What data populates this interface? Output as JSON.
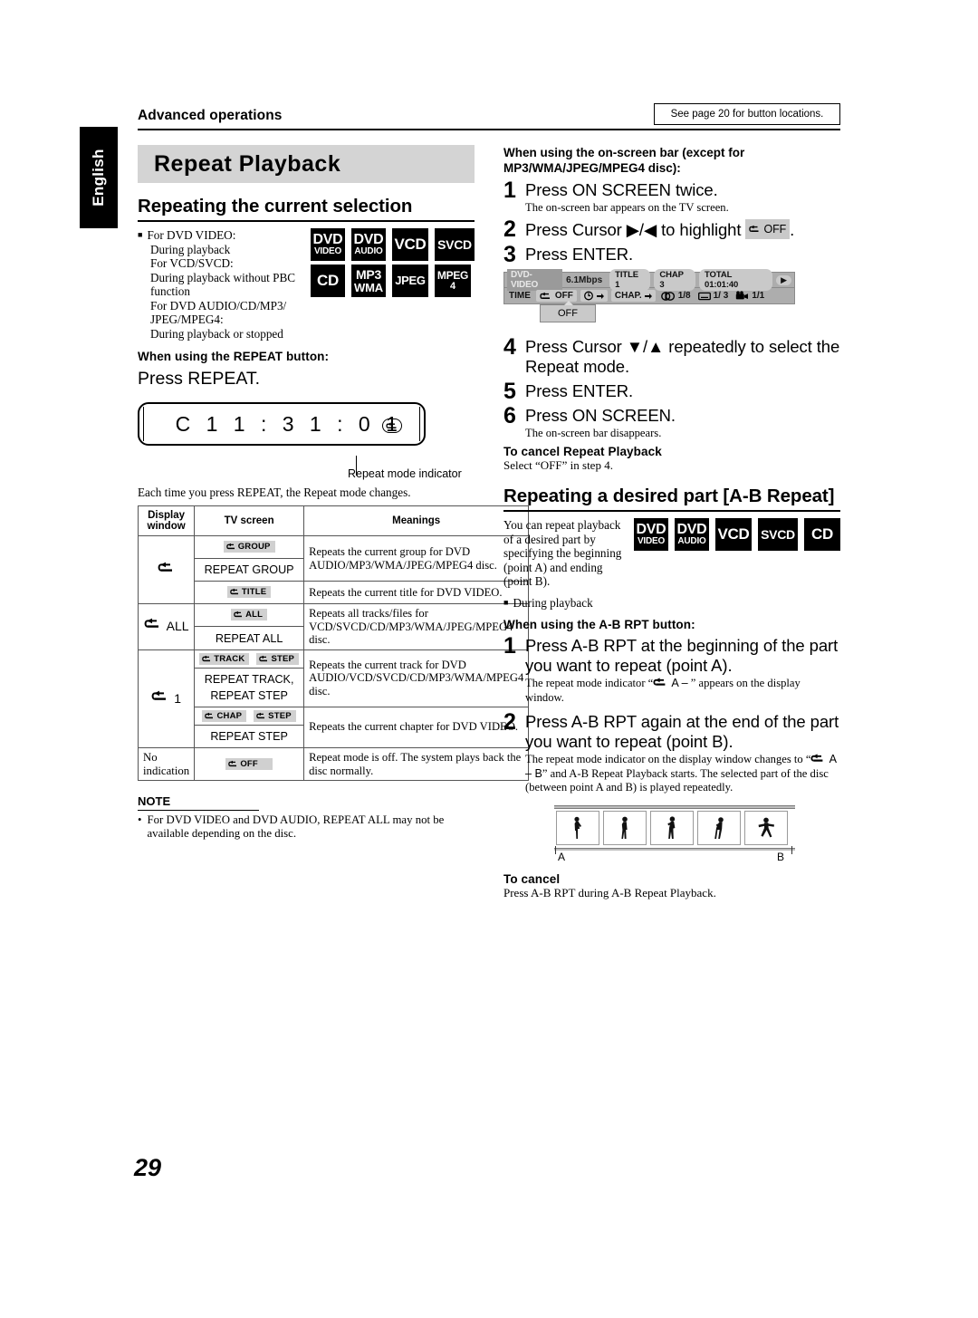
{
  "header": {
    "language_tab": "English",
    "section_label": "Advanced operations",
    "page_reference": "See page 20 for button locations.",
    "page_number": "29"
  },
  "left_column": {
    "banner_title": "Repeat Playback",
    "subsection_title": "Repeating the current selection",
    "intro_lines": [
      "For DVD VIDEO:",
      "During playback",
      "For VCD/SVCD:",
      "During playback without PBC",
      "function",
      "For DVD AUDIO/CD/MP3/",
      "JPEG/MPEG4:",
      "During playback or stopped"
    ],
    "disc_badges": [
      {
        "line1": "DVD",
        "line2": "VIDEO"
      },
      {
        "line1": "DVD",
        "line2": "AUDIO"
      },
      {
        "line1": "VCD",
        "line2": ""
      },
      {
        "line1": "SVCD",
        "line2": ""
      },
      {
        "line1": "CD",
        "line2": ""
      },
      {
        "line1": "MP3",
        "line2": "WMA"
      },
      {
        "line1": "JPEG",
        "line2": ""
      },
      {
        "line1": "MPEG",
        "line2": "4"
      }
    ],
    "button_heading": "When using the REPEAT button:",
    "press_instruction": "Press REPEAT.",
    "display_window_text": "C 1  1 : 3 1 : 0 1",
    "indicator_caption": "Repeat mode indicator",
    "each_time_text": "Each time you press REPEAT, the Repeat mode changes.",
    "table": {
      "headers": [
        "Display window",
        "TV screen",
        "Meanings"
      ],
      "rows": [
        {
          "display_window": "loop",
          "display_window_suffix": "",
          "tv_screens": [
            {
              "kind": "chip",
              "chips": [
                "GROUP"
              ]
            },
            {
              "kind": "plain",
              "text": "REPEAT GROUP"
            }
          ],
          "meaning": "Repeats the current group for DVD AUDIO/MP3/WMA/JPEG/MPEG4 disc."
        },
        {
          "display_window": "",
          "display_window_suffix": "",
          "tv_screens": [
            {
              "kind": "chip",
              "chips": [
                "TITLE"
              ]
            }
          ],
          "meaning": "Repeats the current title for DVD VIDEO."
        },
        {
          "display_window": "loop",
          "display_window_suffix": "ALL",
          "tv_screens": [
            {
              "kind": "chip",
              "chips": [
                "ALL"
              ]
            },
            {
              "kind": "plain",
              "text": "REPEAT ALL"
            }
          ],
          "meaning": "Repeats all tracks/files for VCD/SVCD/CD/MP3/WMA/JPEG/MPEG4 disc."
        },
        {
          "display_window": "loop",
          "display_window_suffix": "1",
          "tv_screens": [
            {
              "kind": "chip",
              "chips": [
                "TRACK",
                "STEP"
              ]
            },
            {
              "kind": "plain",
              "text": "REPEAT TRACK,\nREPEAT STEP"
            }
          ],
          "meaning": "Repeats the current track for DVD AUDIO/VCD/SVCD/CD/MP3/WMA/MPEG4 disc."
        },
        {
          "display_window": "",
          "display_window_suffix": "",
          "tv_screens": [
            {
              "kind": "chip",
              "chips": [
                "CHAP",
                "STEP"
              ]
            },
            {
              "kind": "plain",
              "text": "REPEAT STEP"
            }
          ],
          "meaning": "Repeats the current chapter for DVD VIDEO."
        },
        {
          "display_window": "none",
          "display_window_text": "No indication",
          "tv_screens": [
            {
              "kind": "chip",
              "chips": [
                "OFF"
              ]
            }
          ],
          "meaning": "Repeat mode is off. The system plays back the disc normally."
        }
      ]
    },
    "note": {
      "heading": "NOTE",
      "bullet": "For DVD VIDEO and DVD AUDIO, REPEAT ALL may not be available depending on the disc."
    }
  },
  "right_column": {
    "onscreen_heading": "When using the on-screen bar (except for MP3/WMA/JPEG/MPEG4 disc):",
    "steps": [
      {
        "num": "1",
        "text": "Press ON SCREEN twice.",
        "note": "The on-screen bar appears on the TV screen."
      },
      {
        "num": "2",
        "text_before": "Press Cursor ▶/◀ to highlight",
        "chip": "OFF",
        "text_after": "."
      },
      {
        "num": "3",
        "text": "Press ENTER."
      },
      {
        "num": "4",
        "text": "Press Cursor ▼/▲ repeatedly to select the Repeat mode."
      },
      {
        "num": "5",
        "text": "Press ENTER."
      },
      {
        "num": "6",
        "text": "Press ON SCREEN.",
        "note": "The on-screen bar disappears."
      }
    ],
    "cancel_repeat": {
      "heading": "To cancel Repeat Playback",
      "body": "Select “OFF” in step 4."
    },
    "on_screen_bar": {
      "disc_type": "DVD-VIDEO",
      "bitrate": "6.1Mbps",
      "title": "TITLE  1",
      "chapter": "CHAP  3",
      "total": "TOTAL 01:01:40",
      "row2_time_label": "TIME",
      "row2_repeat": "OFF",
      "row2_chapter": "CHAP.",
      "row2_audio": "1/8",
      "row2_subtitle": "1/ 3",
      "row2_angle": "1/1",
      "dropdown_value": "OFF"
    },
    "ab_section": {
      "title": "Repeating a desired part [A-B Repeat]",
      "intro": "You can repeat playback of a desired part by specifying the beginning (point A) and ending (point B).",
      "during_playback": "During playback",
      "badges": [
        {
          "line1": "DVD",
          "line2": "VIDEO"
        },
        {
          "line1": "DVD",
          "line2": "AUDIO"
        },
        {
          "line1": "VCD",
          "line2": ""
        },
        {
          "line1": "SVCD",
          "line2": ""
        },
        {
          "line1": "CD",
          "line2": ""
        }
      ],
      "button_heading": "When using the A-B RPT button:",
      "steps": [
        {
          "num": "1",
          "text": "Press A-B RPT at the beginning of the part you want to repeat (point A).",
          "note_before": "The repeat mode indicator “",
          "note_indicator": "A –",
          "note_after": "” appears on the display window."
        },
        {
          "num": "2",
          "text": "Press A-B RPT again at the end of the part you want to repeat (point B).",
          "note_before": "The repeat mode indicator on the display window changes to “",
          "note_indicator": "A – B",
          "note_after": "” and A-B Repeat Playback starts. The selected part of the disc (between point A and B) is played repeatedly."
        }
      ],
      "diagram": {
        "label_a": "A",
        "label_b": "B",
        "frame_count": 5
      },
      "cancel": {
        "heading": "To cancel",
        "body": "Press A-B RPT during A-B Repeat Playback."
      }
    }
  },
  "colors": {
    "banner_bg": "#d4d4d4",
    "chip_bg": "#d0d0d0",
    "osb_bg": "#adadad",
    "text": "#000000"
  }
}
